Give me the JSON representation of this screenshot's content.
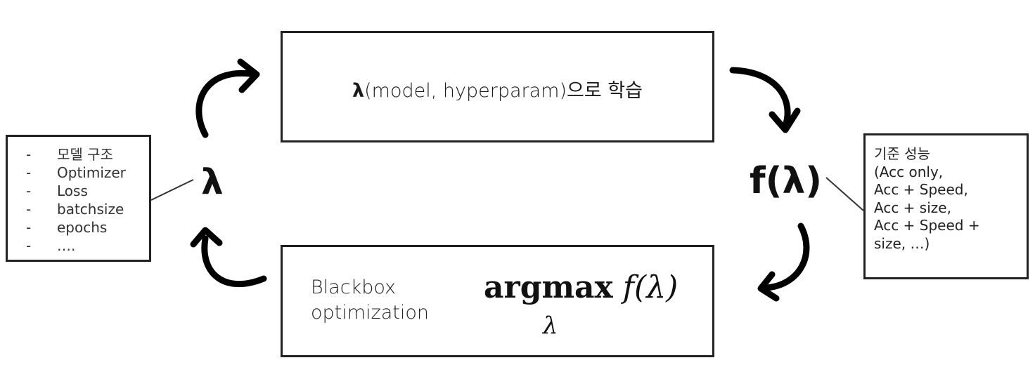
{
  "train": {
    "lambda": "λ",
    "text": "(model, hyperparam)으로 학습"
  },
  "optimize": {
    "label": "Blackbox\noptimization",
    "op": "argmax",
    "fn": "f(λ)",
    "sub": "λ"
  },
  "lambda_symbol": "λ",
  "objective_symbol": "f(λ)",
  "hyperparams": [
    {
      "bullet": "-",
      "text": "모델 구조"
    },
    {
      "bullet": "-",
      "text": "Optimizer"
    },
    {
      "bullet": "-",
      "text": "Loss"
    },
    {
      "bullet": "-",
      "text": "batchsize"
    },
    {
      "bullet": "-",
      "text": "epochs"
    },
    {
      "bullet": "-",
      "text": "…."
    }
  ],
  "metric_text": "기준 성능\n(Acc only,\nAcc + Speed,\nAcc + size,\nAcc + Speed +\nsize, …)",
  "colors": {
    "stroke": "#000000",
    "border": "#222222"
  }
}
